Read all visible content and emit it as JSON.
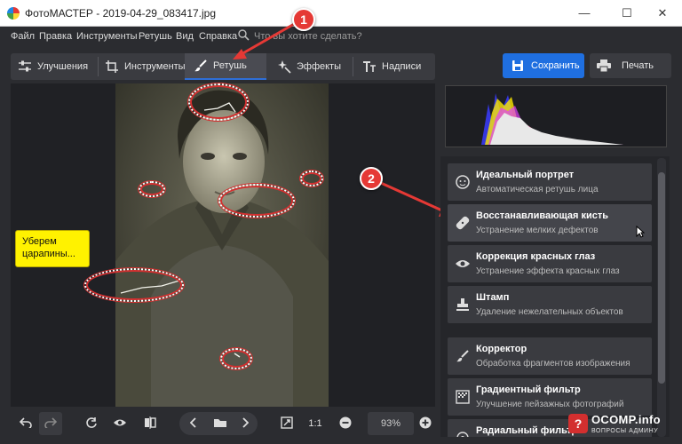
{
  "window": {
    "title": "ФотоМАСТЕР - 2019-04-29_083417.jpg",
    "minimize": "—",
    "maximize": "☐",
    "close": "✕"
  },
  "menu": {
    "items": [
      "Файл",
      "Правка",
      "Инструменты",
      "Ретушь",
      "Вид",
      "Справка"
    ],
    "search_placeholder": "Что вы хотите сделать?"
  },
  "tabs": [
    {
      "label": "Улучшения",
      "icon": "sliders-icon"
    },
    {
      "label": "Инструменты",
      "icon": "crop-icon"
    },
    {
      "label": "Ретушь",
      "icon": "brush-icon",
      "active": true
    },
    {
      "label": "Эффекты",
      "icon": "sparkle-icon"
    },
    {
      "label": "Надписи",
      "icon": "text-icon"
    }
  ],
  "actions": {
    "save": "Сохранить",
    "print": "Печать"
  },
  "tools": [
    {
      "title": "Идеальный портрет",
      "subtitle": "Автоматическая ретушь лица",
      "icon": "face-icon"
    },
    {
      "title": "Восстанавливающая кисть",
      "subtitle": "Устранение мелких дефектов",
      "icon": "bandage-icon"
    },
    {
      "title": "Коррекция красных глаз",
      "subtitle": "Устранение эффекта красных глаз",
      "icon": "eye-icon"
    },
    {
      "title": "Штамп",
      "subtitle": "Удаление нежелательных объектов",
      "icon": "stamp-icon"
    },
    {
      "title": "Корректор",
      "subtitle": "Обработка фрагментов изображения",
      "icon": "brush-icon"
    },
    {
      "title": "Градиентный фильтр",
      "subtitle": "Улучшение пейзажных фотографий",
      "icon": "gradient-icon"
    },
    {
      "title": "Радиальный фильтр",
      "subtitle": "",
      "icon": "radial-icon"
    }
  ],
  "annotations": {
    "callout": "Уберем царапины...",
    "marker1": "1",
    "marker2": "2"
  },
  "bottom": {
    "ratio": "1:1",
    "zoom": "93%"
  },
  "watermark": {
    "name": "OCOMP.info",
    "sub": "ВОПРОСЫ АДМИНУ"
  },
  "colors": {
    "accent": "#1f6fe0",
    "annotation": "#e53935",
    "callout_bg": "#fff200",
    "panel_bg": "#25262a"
  }
}
